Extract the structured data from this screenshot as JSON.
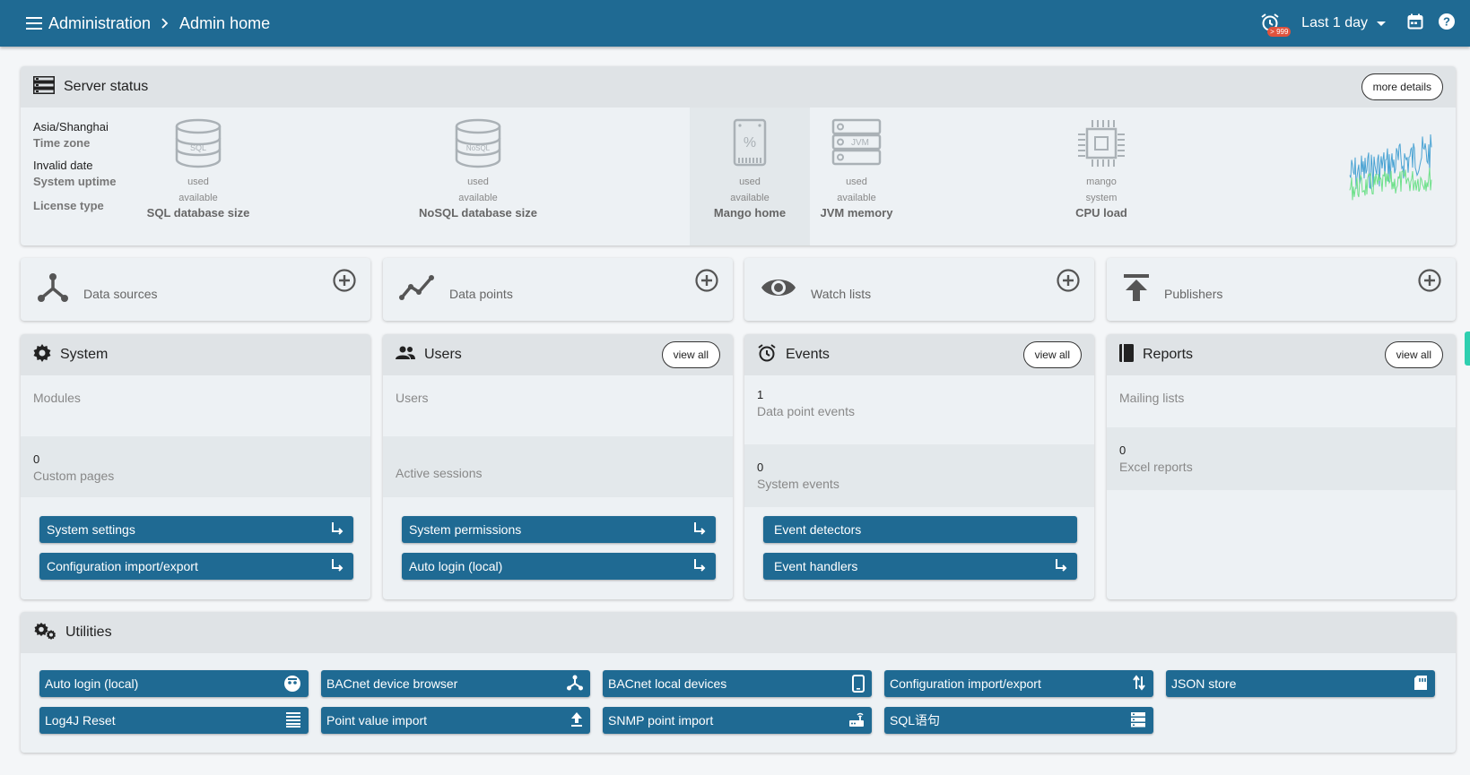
{
  "header": {
    "crumb_root": "Administration",
    "crumb_current": "Admin home",
    "alarm_badge": "> 999",
    "time_range": "Last 1 day"
  },
  "server_status": {
    "title": "Server status",
    "more_details": "more details",
    "timezone_value": "Asia/Shanghai",
    "timezone_label": "Time zone",
    "uptime_value": "Invalid date",
    "uptime_label": "System uptime",
    "license_label": "License type",
    "metrics": [
      {
        "icon": "sql-database-icon",
        "line1": "used",
        "line2": "available",
        "name": "SQL database size"
      },
      {
        "icon": "nosql-database-icon",
        "line1": "used",
        "line2": "available",
        "name": "NoSQL database size"
      },
      {
        "icon": "disk-percent-icon",
        "line1": "used",
        "line2": "available",
        "name": "Mango home"
      },
      {
        "icon": "jvm-memory-icon",
        "line1": "used",
        "line2": "available",
        "name": "JVM memory"
      },
      {
        "icon": "cpu-icon",
        "line1": "mango",
        "line2": "system",
        "name": "CPU load"
      }
    ],
    "sparkline_colors": [
      "#4aa3d3",
      "#6ee08a"
    ]
  },
  "shortcuts": [
    {
      "label": "Data sources",
      "icon": "data-sources-icon"
    },
    {
      "label": "Data points",
      "icon": "data-points-icon"
    },
    {
      "label": "Watch lists",
      "icon": "eye-icon"
    },
    {
      "label": "Publishers",
      "icon": "publish-icon"
    }
  ],
  "system": {
    "title": "System",
    "modules_label": "Modules",
    "custom_pages_count": "0",
    "custom_pages_label": "Custom pages",
    "btn_settings": "System settings",
    "btn_config": "Configuration import/export"
  },
  "users": {
    "title": "Users",
    "view_all": "view all",
    "users_label": "Users",
    "sessions_label": "Active sessions",
    "btn_permissions": "System permissions",
    "btn_autologin": "Auto login (local)"
  },
  "events": {
    "title": "Events",
    "view_all": "view all",
    "dp_events_count": "1",
    "dp_events_label": "Data point events",
    "sys_events_count": "0",
    "sys_events_label": "System events",
    "btn_detectors": "Event detectors",
    "btn_handlers": "Event handlers"
  },
  "reports": {
    "title": "Reports",
    "view_all": "view all",
    "mailing_label": "Mailing lists",
    "excel_count": "0",
    "excel_label": "Excel reports"
  },
  "utilities": {
    "title": "Utilities",
    "items": [
      {
        "label": "Auto login (local)",
        "icon": "robot-face-icon"
      },
      {
        "label": "BACnet device browser",
        "icon": "network-tree-icon"
      },
      {
        "label": "BACnet local devices",
        "icon": "device-icon"
      },
      {
        "label": "Configuration import/export",
        "icon": "import-export-icon"
      },
      {
        "label": "JSON store",
        "icon": "json-store-icon"
      },
      {
        "label": "Log4J Reset",
        "icon": "list-lines-icon"
      },
      {
        "label": "Point value import",
        "icon": "upload-icon"
      },
      {
        "label": "SNMP point import",
        "icon": "router-icon"
      },
      {
        "label": "SQL语句",
        "icon": "sql-storage-icon"
      }
    ]
  }
}
